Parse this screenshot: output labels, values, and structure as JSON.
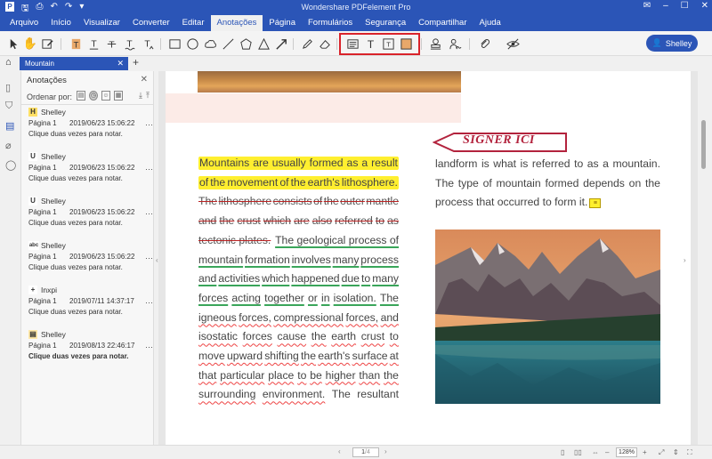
{
  "window": {
    "title": "Wondershare PDFelement Pro",
    "controls": [
      "mail-icon",
      "minimize-icon",
      "maximize-icon",
      "close-icon"
    ]
  },
  "menu": {
    "items": [
      "Arquivo",
      "Início",
      "Visualizar",
      "Converter",
      "Editar",
      "Anotações",
      "Página",
      "Formulários",
      "Segurança",
      "Compartilhar",
      "Ajuda"
    ],
    "active": "Anotações"
  },
  "toolbar": {
    "user_label": "Shelley",
    "highlighted_group": [
      "text-box-icon",
      "typewriter-icon",
      "callout-icon",
      "area-highlight-icon"
    ]
  },
  "tab": {
    "doc_title": "Mountain"
  },
  "panel": {
    "title": "Anotações",
    "sort_label": "Ordenar por:",
    "notes": [
      {
        "icon": "H",
        "icon_color": "#ffe066",
        "author": "Shelley",
        "page": "Página 1",
        "date": "2019/06/23 15:06:22",
        "message": "Clique duas vezes para notar.",
        "bold": false
      },
      {
        "icon": "U",
        "icon_color": "#ffffff",
        "author": "Shelley",
        "page": "Página 1",
        "date": "2019/06/23 15:06:22",
        "message": "Clique duas vezes para notar.",
        "bold": false
      },
      {
        "icon": "U",
        "icon_color": "#ffffff",
        "author": "Shelley",
        "page": "Página 1",
        "date": "2019/06/23 15:06:22",
        "message": "Clique duas vezes para notar.",
        "bold": false
      },
      {
        "icon": "abc",
        "icon_color": "#ffffff",
        "author": "Shelley",
        "page": "Página 1",
        "date": "2019/06/23 15:06:22",
        "message": "Clique duas vezes para notar.",
        "bold": false
      },
      {
        "icon": "+",
        "icon_color": "#ffffff",
        "author": "Inxpi",
        "page": "Página 1",
        "date": "2019/07/11 14:37:17",
        "message": "Clique duas vezes para notar.",
        "bold": false
      },
      {
        "icon": "▤",
        "icon_color": "#ffe9a8",
        "author": "Shelley",
        "page": "Página 1",
        "date": "2019/08/13 22:46:17",
        "message": "Clique duas vezes para notar.",
        "bold": true
      }
    ]
  },
  "document": {
    "stamp_text": "SIGNER ICI",
    "left_lines": [
      [
        "Mountains",
        "are",
        "usually",
        "formed",
        "as",
        "a",
        "result"
      ],
      [
        "of",
        "the",
        "movement",
        "of",
        "the",
        "earth's",
        "lithosphere."
      ],
      [
        "The",
        "lithosphere",
        "consists",
        "of",
        "the",
        "outer",
        "mantle"
      ],
      [
        "and",
        "the",
        "crust",
        "which",
        "are",
        "also",
        "referred",
        "to",
        "as"
      ],
      [
        "tectonic plates.",
        "The geological process of"
      ],
      [
        "mountain",
        "formation",
        "involves",
        "many",
        "process"
      ],
      [
        "and",
        "activities",
        "which",
        "happened",
        "due",
        "to",
        "many"
      ],
      [
        "forces",
        "acting",
        "together",
        "or",
        "in",
        "isolation.",
        "The"
      ],
      [
        "igneous",
        "forces,",
        "compressional",
        "forces,",
        "and"
      ],
      [
        "isostatic",
        "forces",
        "cause",
        "the",
        "earth",
        "crust",
        "to"
      ],
      [
        "move",
        "upward",
        "shifting",
        "the",
        "earth's",
        "surface",
        "at"
      ],
      [
        "that",
        "particular",
        "place",
        "to",
        "be",
        "higher",
        "than",
        "the"
      ],
      [
        "surrounding",
        "environment.",
        "The",
        "resultant"
      ]
    ],
    "right_lines": [
      [
        "landform",
        "is",
        "what",
        "is",
        "referred",
        "to",
        "as",
        "a",
        "mountain."
      ],
      [
        "The",
        "type",
        "of",
        "mountain",
        "formed",
        "depends",
        "on",
        "the"
      ],
      [
        "process that occurred to form it."
      ]
    ]
  },
  "status": {
    "page_current": "1",
    "page_total": "/4",
    "zoom": "128%"
  }
}
